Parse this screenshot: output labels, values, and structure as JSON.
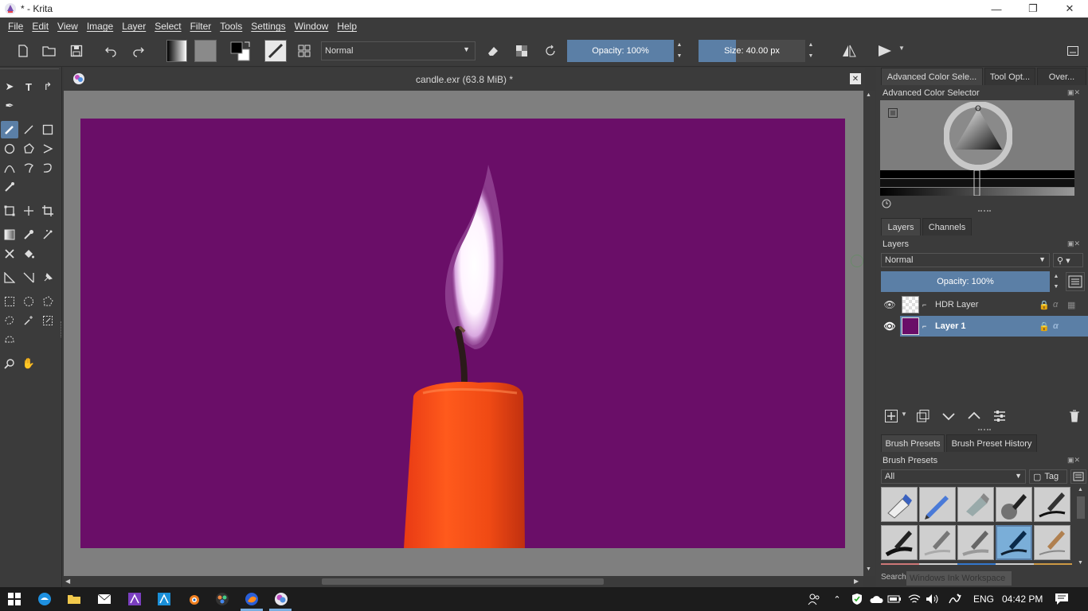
{
  "window": {
    "title": "* - Krita",
    "minimize": "—",
    "restore": "❐",
    "close": "✕"
  },
  "menu": [
    "File",
    "Edit",
    "View",
    "Image",
    "Layer",
    "Select",
    "Filter",
    "Tools",
    "Settings",
    "Window",
    "Help"
  ],
  "toolbar": {
    "blend_mode": "Normal",
    "opacity_label": "Opacity:",
    "opacity_value": "100%",
    "size_label": "Size:",
    "size_value": "40.00 px"
  },
  "document": {
    "tab_title": "candle.exr (63.8 MiB) *",
    "canvas_color": "#6a0e68"
  },
  "dock": {
    "top_tabs": [
      "Advanced Color Sele...",
      "Tool Opt...",
      "Over..."
    ],
    "color_selector_title": "Advanced Color Selector",
    "layer_tabs": [
      "Layers",
      "Channels"
    ],
    "layers_title": "Layers",
    "layers_blend": "Normal",
    "layers_opacity": "Opacity:  100%",
    "layers": [
      {
        "name": "HDR Layer",
        "selected": false
      },
      {
        "name": "Layer 1",
        "selected": true
      }
    ],
    "brush_tabs": [
      "Brush Presets",
      "Brush Preset History"
    ],
    "brush_title": "Brush Presets",
    "brush_filter": "All",
    "brush_tag": "Tag",
    "search_label": "Search",
    "search_overlay": "Windows Ink Workspace"
  },
  "taskbar": {
    "lang": "ENG",
    "time": "04:42 PM"
  },
  "colors": {
    "accent": "#5b7fa6",
    "bg": "#3b3b3b"
  }
}
